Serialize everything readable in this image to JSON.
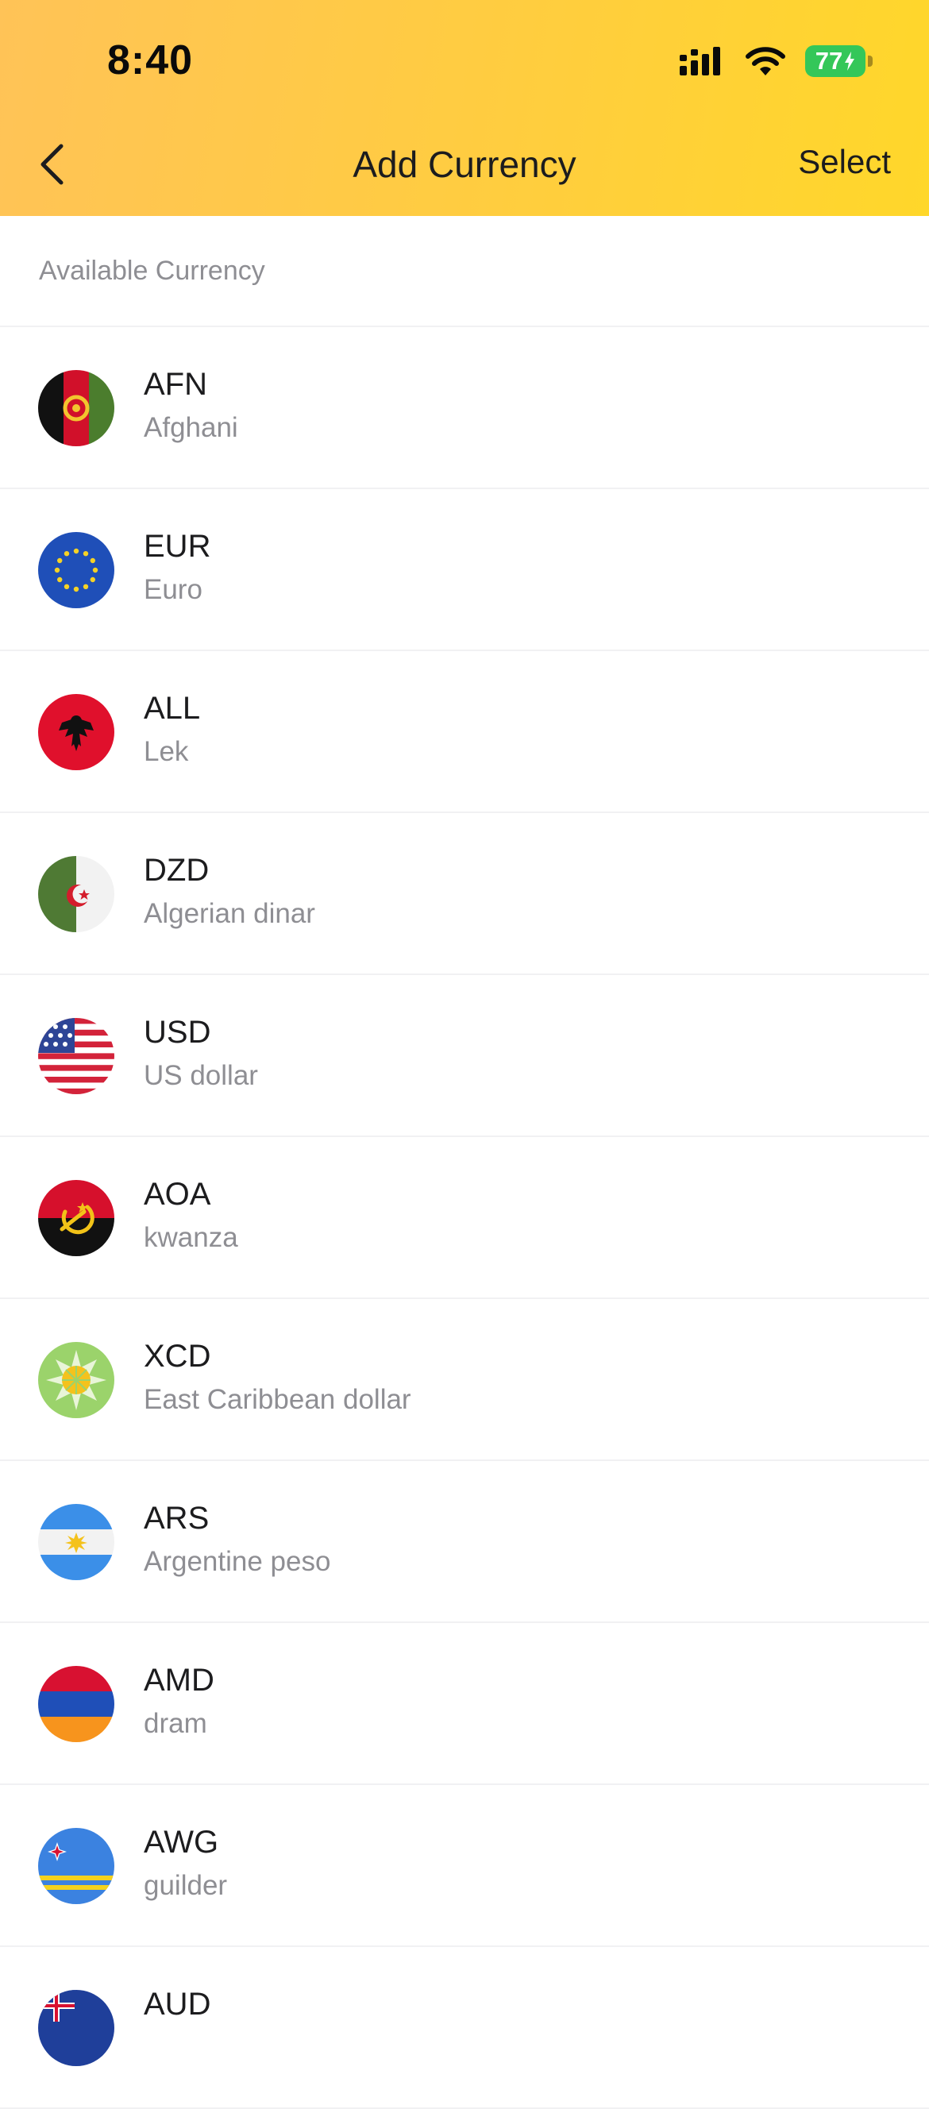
{
  "status_bar": {
    "time": "8:40",
    "battery_level": "77",
    "icons": [
      "signal-icon",
      "wifi-icon",
      "battery-charging-icon"
    ]
  },
  "nav": {
    "back_icon": "chevron-left-icon",
    "title": "Add Currency",
    "select_label": "Select"
  },
  "section": {
    "title": "Available Currency"
  },
  "currencies": [
    {
      "code": "AFN",
      "name": "Afghani",
      "flag": "afghanistan-flag-icon"
    },
    {
      "code": "EUR",
      "name": "Euro",
      "flag": "eu-flag-icon"
    },
    {
      "code": "ALL",
      "name": "Lek",
      "flag": "albania-flag-icon"
    },
    {
      "code": "DZD",
      "name": "Algerian dinar",
      "flag": "algeria-flag-icon"
    },
    {
      "code": "USD",
      "name": "US dollar",
      "flag": "usa-flag-icon"
    },
    {
      "code": "AOA",
      "name": "kwanza",
      "flag": "angola-flag-icon"
    },
    {
      "code": "XCD",
      "name": "East Caribbean dollar",
      "flag": "east-caribbean-flag-icon"
    },
    {
      "code": "ARS",
      "name": "Argentine peso",
      "flag": "argentina-flag-icon"
    },
    {
      "code": "AMD",
      "name": "dram",
      "flag": "armenia-flag-icon"
    },
    {
      "code": "AWG",
      "name": "guilder",
      "flag": "aruba-flag-icon"
    },
    {
      "code": "AUD",
      "name": "",
      "flag": "australia-flag-icon"
    }
  ],
  "colors": {
    "header_gradient_start": "#ffc357",
    "header_gradient_end": "#ffd72a",
    "battery": "#34c759",
    "secondary_text": "#8e8e93"
  }
}
